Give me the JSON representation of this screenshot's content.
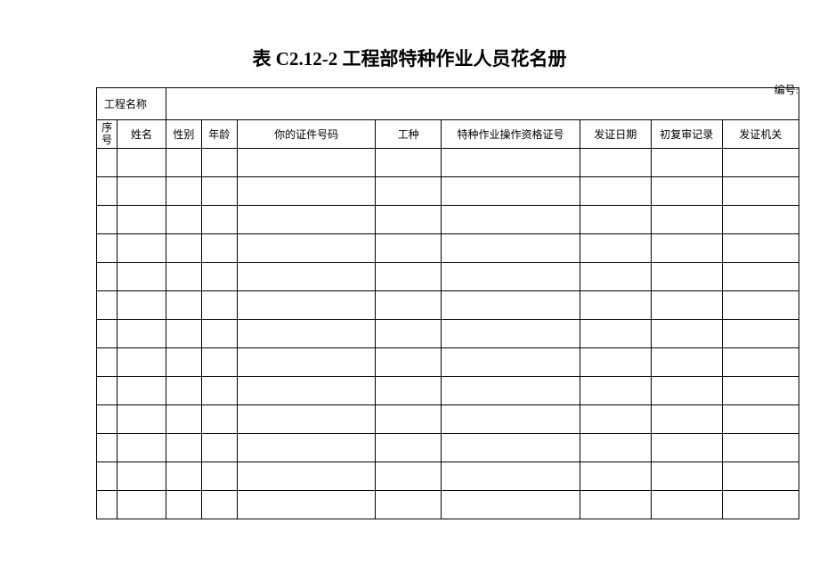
{
  "title": "表 C2.12-2 工程部特种作业人员花名册",
  "serial_label": "编号:",
  "project_name_label": "工程名称",
  "headers": {
    "seq": "序号",
    "name": "姓名",
    "gender": "性别",
    "age": "年龄",
    "id_number": "你的证件号码",
    "work_type": "工种",
    "qualification": "特种作业操作资格证号",
    "issue_date": "发证日期",
    "review_record": "初复审记录",
    "issue_agency": "发证机关"
  },
  "project_name_value": "",
  "rows": [
    {
      "seq": "",
      "name": "",
      "gender": "",
      "age": "",
      "id_number": "",
      "work_type": "",
      "qualification": "",
      "issue_date": "",
      "review_record": "",
      "issue_agency": ""
    },
    {
      "seq": "",
      "name": "",
      "gender": "",
      "age": "",
      "id_number": "",
      "work_type": "",
      "qualification": "",
      "issue_date": "",
      "review_record": "",
      "issue_agency": ""
    },
    {
      "seq": "",
      "name": "",
      "gender": "",
      "age": "",
      "id_number": "",
      "work_type": "",
      "qualification": "",
      "issue_date": "",
      "review_record": "",
      "issue_agency": ""
    },
    {
      "seq": "",
      "name": "",
      "gender": "",
      "age": "",
      "id_number": "",
      "work_type": "",
      "qualification": "",
      "issue_date": "",
      "review_record": "",
      "issue_agency": ""
    },
    {
      "seq": "",
      "name": "",
      "gender": "",
      "age": "",
      "id_number": "",
      "work_type": "",
      "qualification": "",
      "issue_date": "",
      "review_record": "",
      "issue_agency": ""
    },
    {
      "seq": "",
      "name": "",
      "gender": "",
      "age": "",
      "id_number": "",
      "work_type": "",
      "qualification": "",
      "issue_date": "",
      "review_record": "",
      "issue_agency": ""
    },
    {
      "seq": "",
      "name": "",
      "gender": "",
      "age": "",
      "id_number": "",
      "work_type": "",
      "qualification": "",
      "issue_date": "",
      "review_record": "",
      "issue_agency": ""
    },
    {
      "seq": "",
      "name": "",
      "gender": "",
      "age": "",
      "id_number": "",
      "work_type": "",
      "qualification": "",
      "issue_date": "",
      "review_record": "",
      "issue_agency": ""
    },
    {
      "seq": "",
      "name": "",
      "gender": "",
      "age": "",
      "id_number": "",
      "work_type": "",
      "qualification": "",
      "issue_date": "",
      "review_record": "",
      "issue_agency": ""
    },
    {
      "seq": "",
      "name": "",
      "gender": "",
      "age": "",
      "id_number": "",
      "work_type": "",
      "qualification": "",
      "issue_date": "",
      "review_record": "",
      "issue_agency": ""
    },
    {
      "seq": "",
      "name": "",
      "gender": "",
      "age": "",
      "id_number": "",
      "work_type": "",
      "qualification": "",
      "issue_date": "",
      "review_record": "",
      "issue_agency": ""
    },
    {
      "seq": "",
      "name": "",
      "gender": "",
      "age": "",
      "id_number": "",
      "work_type": "",
      "qualification": "",
      "issue_date": "",
      "review_record": "",
      "issue_agency": ""
    },
    {
      "seq": "",
      "name": "",
      "gender": "",
      "age": "",
      "id_number": "",
      "work_type": "",
      "qualification": "",
      "issue_date": "",
      "review_record": "",
      "issue_agency": ""
    }
  ]
}
